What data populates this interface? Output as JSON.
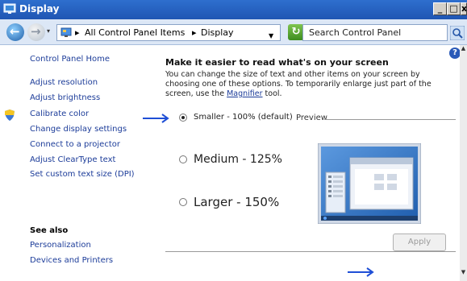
{
  "window": {
    "title": "Display",
    "minimize": "_",
    "restore": "□",
    "close": "x"
  },
  "address_bar": {
    "crumbs": [
      "All Control Panel Items",
      "Display"
    ],
    "search_placeholder": "Search Control Panel"
  },
  "sidebar": {
    "home": "Control Panel Home",
    "links": [
      "Adjust resolution",
      "Adjust brightness",
      "Calibrate color",
      "Change display settings",
      "Connect to a projector",
      "Adjust ClearType text",
      "Set custom text size (DPI)"
    ],
    "see_also_title": "See also",
    "see_also": [
      "Personalization",
      "Devices and Printers"
    ]
  },
  "main": {
    "heading": "Make it easier to read what's on your screen",
    "description_prefix": "You can change the size of text and other items on your screen by choosing one of these options. To temporarily enlarge just part of the screen, use the ",
    "magnifier_link": "Magnifier",
    "description_suffix": " tool.",
    "options": [
      {
        "label": "Smaller - 100% (default)",
        "selected": true
      },
      {
        "label": "Medium - 125%",
        "selected": false
      },
      {
        "label": "Larger - 150%",
        "selected": false
      }
    ],
    "preview_label": "Preview",
    "apply_label": "Apply"
  },
  "colors": {
    "link": "#1c3c99",
    "arrow": "#1f4fd6"
  }
}
